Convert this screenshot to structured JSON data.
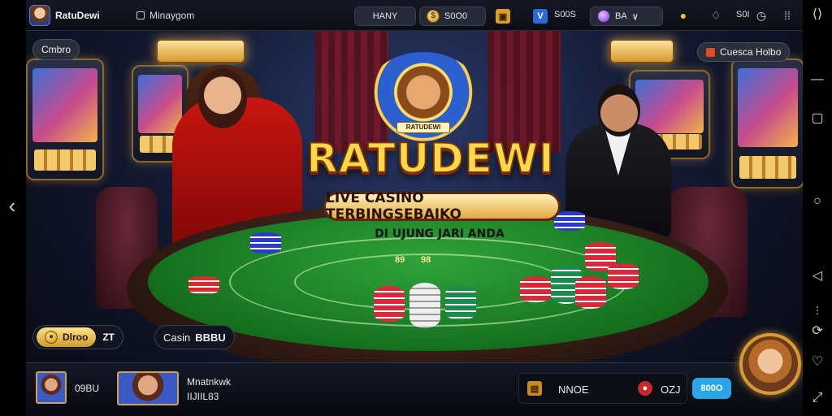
{
  "topbar": {
    "username": "RatuDewi",
    "tab2_label": "Minaygom",
    "search_label": "HANY",
    "coin_label": "S0O0",
    "v_label": "S00S",
    "a_label": "BA",
    "right_count": "S0I"
  },
  "scene": {
    "left_chip": "Cmbro",
    "right_chip": "Cuesca Holbo",
    "crest_label": "RATUDEWI",
    "title": "RATUDEWI",
    "banner": "LIVE CASINO TERBINGSEBAIKO",
    "subtitle": "DI UJUNG JARI ANDA",
    "felt_numbers": [
      "89",
      "98"
    ]
  },
  "floating": {
    "bonus_label": "Dlroo",
    "bonus_value": "ZT",
    "cashin_label": "Casin",
    "cashin_value": "BBBU"
  },
  "bottombar": {
    "player1_value": "09BU",
    "player2_title": "Mnatnkwk",
    "player2_sub": "IIJIIL83",
    "right_label": "NNOE",
    "right_value": "OZJ",
    "deposit_label": "800O"
  },
  "colors": {
    "accent_gold": "#ffd84a",
    "felt_green": "#2fa33a",
    "deposit_blue": "#2aa6e8"
  }
}
